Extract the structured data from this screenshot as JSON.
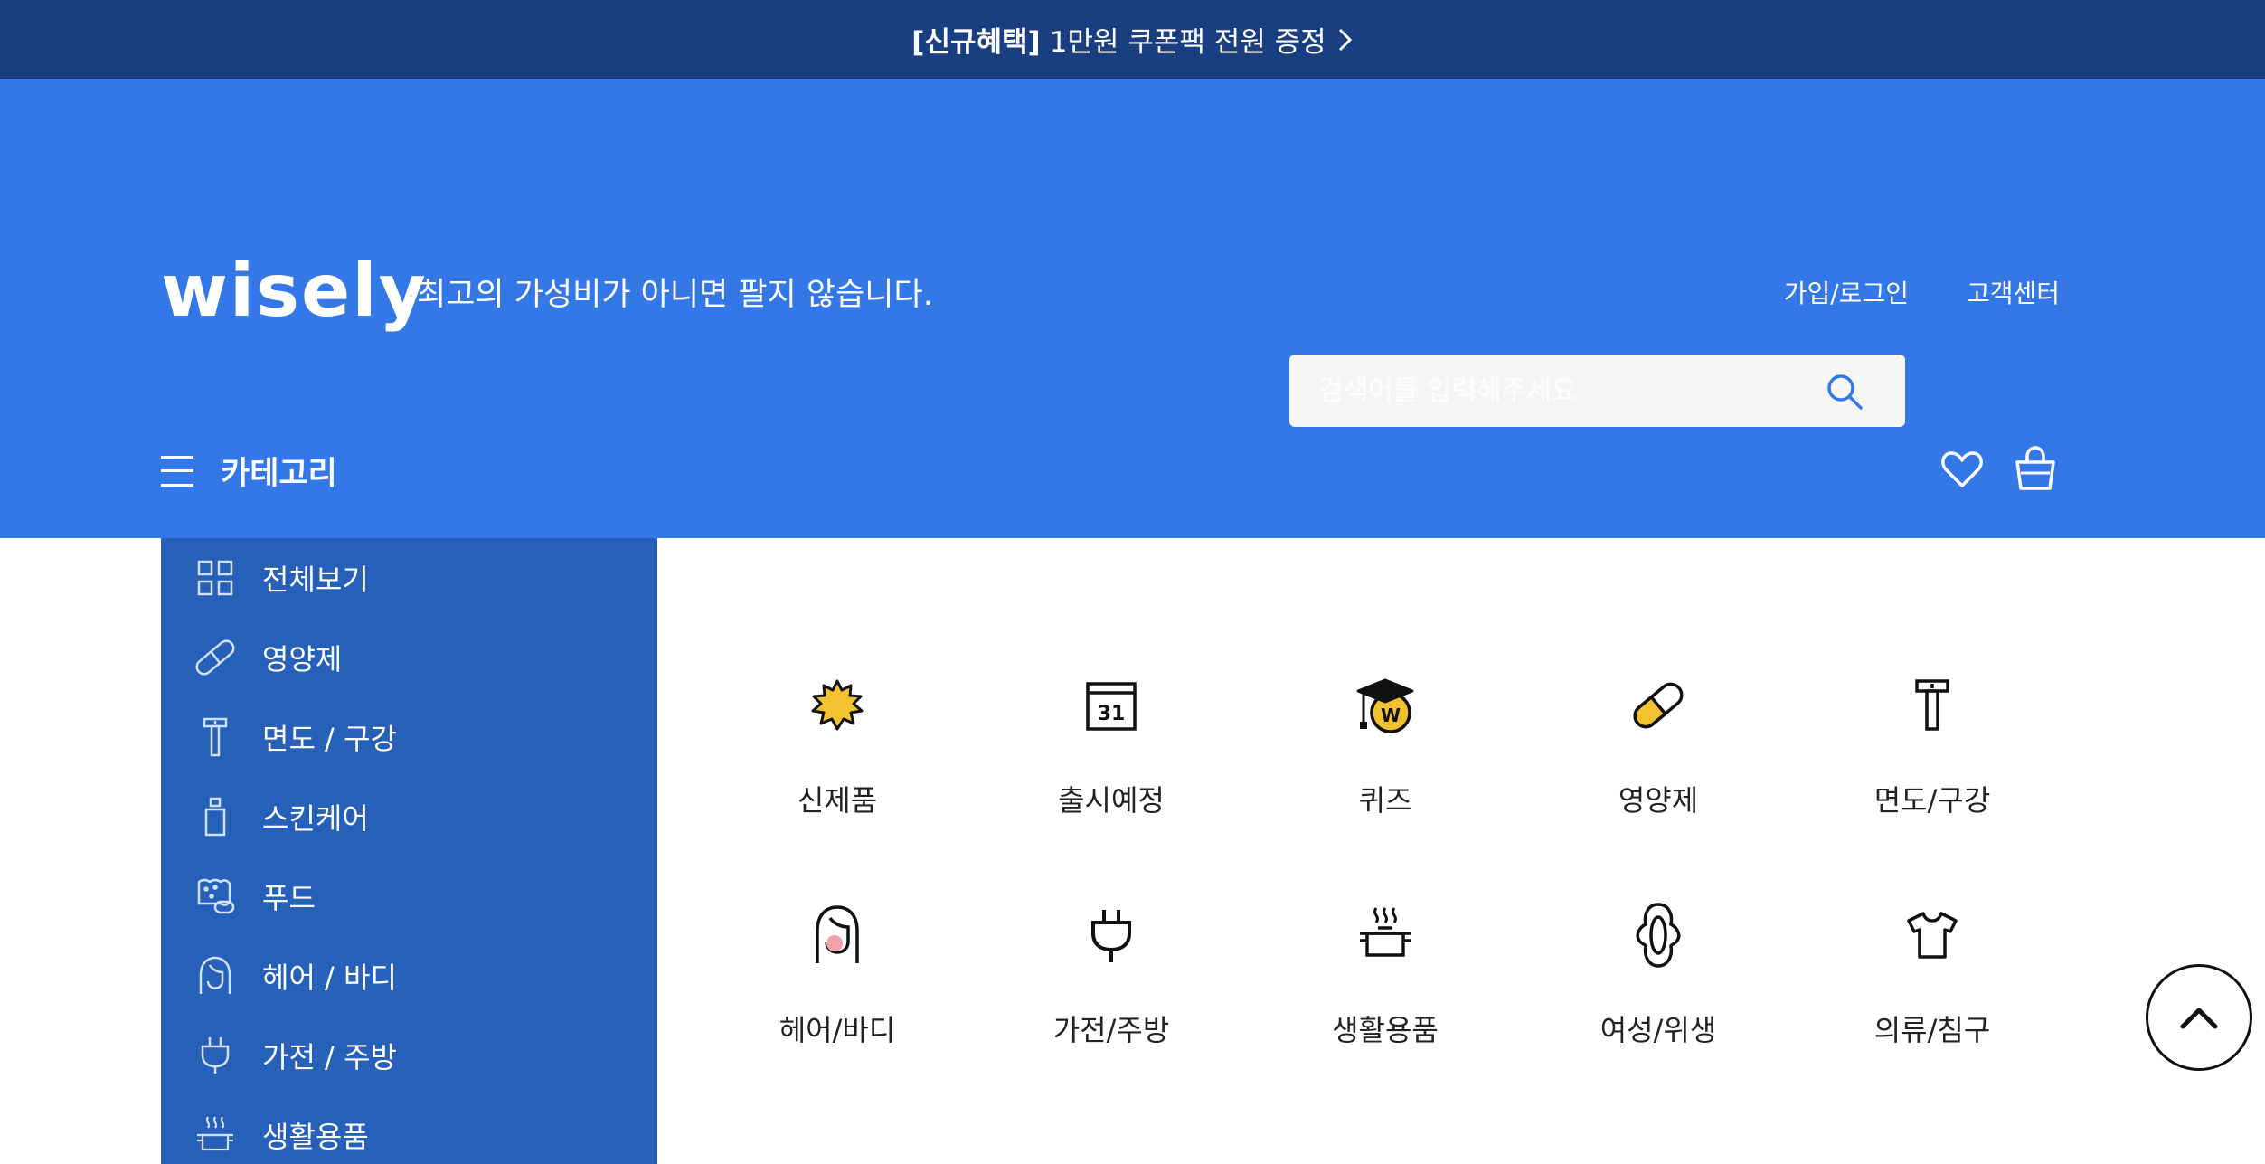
{
  "promo": {
    "bold": "[신규혜택]",
    "text": "1만원 쿠폰팩 전원 증정"
  },
  "header": {
    "logo": "wisely",
    "tagline": "최고의 가성비가 아니면 팔지 않습니다.",
    "links": {
      "login": "가입/로그인",
      "support": "고객센터"
    },
    "category_label": "카테고리",
    "search_placeholder": "검색어를 입력해주세요"
  },
  "sidebar": {
    "items": [
      {
        "label": "전체보기",
        "icon": "grid-icon"
      },
      {
        "label": "영양제",
        "icon": "pill-icon"
      },
      {
        "label": "면도 / 구강",
        "icon": "razor-icon"
      },
      {
        "label": "스킨케어",
        "icon": "bottle-icon"
      },
      {
        "label": "푸드",
        "icon": "food-icon"
      },
      {
        "label": "헤어 / 바디",
        "icon": "hair-icon"
      },
      {
        "label": "가전 / 주방",
        "icon": "plug-icon"
      },
      {
        "label": "생활용품",
        "icon": "pot-icon"
      }
    ]
  },
  "grid": {
    "items": [
      {
        "label": "신제품",
        "icon": "new-badge-icon"
      },
      {
        "label": "출시예정",
        "icon": "calendar-icon",
        "day": "31"
      },
      {
        "label": "퀴즈",
        "icon": "graduation-icon",
        "badge": "W"
      },
      {
        "label": "영양제",
        "icon": "pill-icon"
      },
      {
        "label": "면도/구강",
        "icon": "razor-icon"
      },
      {
        "label": "헤어/바디",
        "icon": "hair-icon"
      },
      {
        "label": "가전/주방",
        "icon": "plug-icon"
      },
      {
        "label": "생활용품",
        "icon": "pot-icon"
      },
      {
        "label": "여성/위생",
        "icon": "pad-icon"
      },
      {
        "label": "의류/침구",
        "icon": "shirt-icon"
      }
    ]
  },
  "colors": {
    "banner": "#1a3f80",
    "header": "#3477e6",
    "sidebar": "#2760b8",
    "accent_yellow": "#f2c230"
  }
}
